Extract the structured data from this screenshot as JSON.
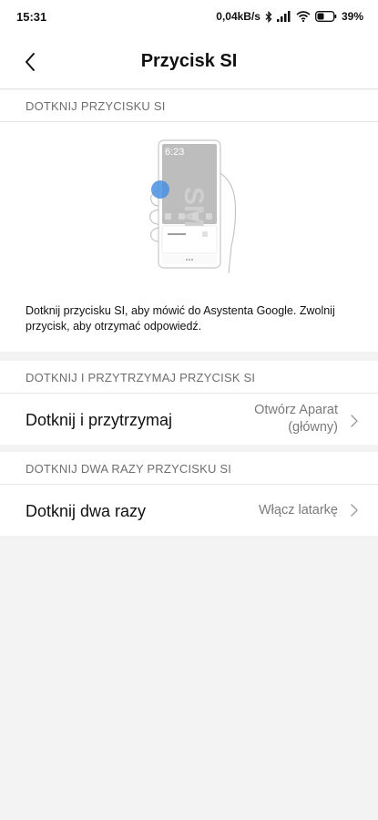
{
  "status": {
    "time": "15:31",
    "network_speed": "0,04kB/s",
    "battery": "39%",
    "icons": [
      "bluetooth-icon",
      "signal-icon",
      "wifi-icon",
      "battery-icon"
    ]
  },
  "header": {
    "back_icon": "chevron-left-icon",
    "title": "Przycisk SI"
  },
  "section_tap": {
    "header": "DOTKNIJ PRZYCISKU SI",
    "illustration": {
      "screen_time": "6:23",
      "icon": "phone-illustration"
    },
    "description": "Dotknij przycisku SI, aby mówić do Asystenta Google. Zwolnij przycisk, aby otrzymać odpowiedź."
  },
  "section_hold": {
    "header": "DOTKNIJ I PRZYTRZYMAJ PRZYCISK SI",
    "row_label": "Dotknij i przytrzymaj",
    "row_value_line1": "Otwórz Aparat",
    "row_value_line2": "(główny)"
  },
  "section_double": {
    "header": "DOTKNIJ DWA RAZY PRZYCISKU SI",
    "row_label": "Dotknij dwa razy",
    "row_value": "Włącz latarkę"
  },
  "colors": {
    "background": "#f3f3f3",
    "surface": "#ffffff",
    "accent_touch": "#4a90e2",
    "secondary_text": "#7a7a7a"
  }
}
